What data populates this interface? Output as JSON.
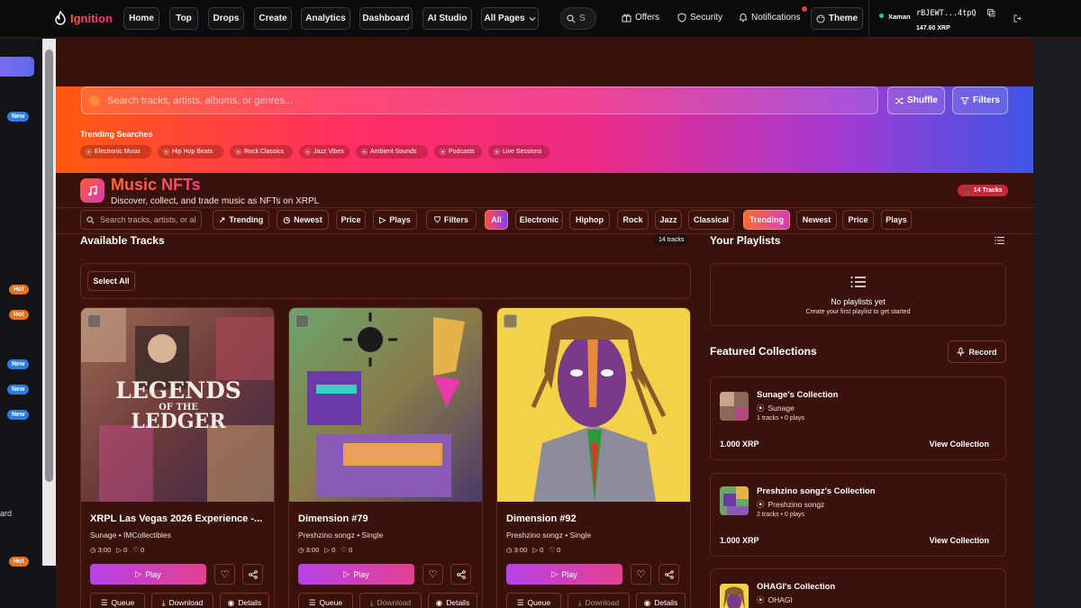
{
  "app": {
    "name": "Ignition"
  },
  "nav": {
    "items": [
      "Home",
      "Top",
      "Drops",
      "Create",
      "Analytics",
      "Dashboard",
      "AI Studio",
      "All Pages"
    ],
    "search_short": "S"
  },
  "top_links": {
    "offers": "Offers",
    "security": "Security",
    "notifications": "Notifications",
    "theme": "Theme"
  },
  "wallet": {
    "provider": "Xaman",
    "address": "rBJEWT...4tpQ",
    "balance": "147.60 XRP"
  },
  "sidebar": {
    "badges": [
      "New",
      "Hot",
      "Hot",
      "New",
      "New",
      "New",
      "Hot"
    ],
    "partial_text": "ard"
  },
  "hero": {
    "search_placeholder": "Search tracks, artists, albums, or genres...",
    "shuffle": "Shuffle",
    "filters": "Filters",
    "trending_label": "Trending Searches",
    "trending": [
      "Electronic Music",
      "Hip Hop Beats",
      "Rock Classics",
      "Jazz Vibes",
      "Ambient Sounds",
      "Podcasts",
      "Live Sessions"
    ]
  },
  "header": {
    "title": "Music NFTs",
    "subtitle": "Discover, collect, and trade music as NFTs on XRPL",
    "tracks_badge": "14 Tracks"
  },
  "filters": {
    "search_placeholder": "Search tracks, artists, or al",
    "sort_a": [
      "Trending",
      "Newest",
      "Price",
      "Plays",
      "Filters"
    ],
    "genres": [
      "All",
      "Electronic",
      "Hiphop",
      "Rock",
      "Jazz",
      "Classical"
    ],
    "sort_b": [
      "Trending",
      "Newest",
      "Price",
      "Plays"
    ]
  },
  "available": {
    "title": "Available Tracks",
    "count": "14 tracks",
    "select_all": "Select All"
  },
  "tracks": [
    {
      "title": "XRPL Las Vegas 2026 Experience -...",
      "meta": "Sunage • IMCollectibles",
      "duration": "3:00",
      "plays": "0",
      "likes": "0",
      "play": "Play",
      "queue": "Queue",
      "download": "Download",
      "details": "Details",
      "art_text": [
        "LEGENDS",
        "OF THE",
        "LEDGER"
      ]
    },
    {
      "title": "Dimension #79",
      "meta": "Preshzino songz • Single",
      "duration": "3:00",
      "plays": "0",
      "likes": "0",
      "play": "Play",
      "queue": "Queue",
      "download": "Download",
      "details": "Details"
    },
    {
      "title": "Dimension #92",
      "meta": "Preshzino songz • Single",
      "duration": "3:00",
      "plays": "0",
      "likes": "0",
      "play": "Play",
      "queue": "Queue",
      "download": "Download",
      "details": "Details"
    }
  ],
  "playlists": {
    "title": "Your Playlists",
    "empty_title": "No playlists yet",
    "empty_sub": "Create your first playlist to get started"
  },
  "featured": {
    "title": "Featured Collections",
    "record": "Record",
    "collections": [
      {
        "name": "Sunage's Collection",
        "artist": "Sunage",
        "tracks": "1 tracks",
        "plays": "0 plays",
        "price": "1.000 XRP",
        "view": "View Collection"
      },
      {
        "name": "Preshzino songz's Collection",
        "artist": "Preshzino songz",
        "tracks": "2 tracks",
        "plays": "0 plays",
        "price": "1.000 XRP",
        "view": "View Collection"
      },
      {
        "name": "OHAGI's Collection",
        "artist": "OHAGI"
      }
    ]
  },
  "colors": {
    "bg": "#3a120b",
    "accent": "#ff3f86",
    "topbar": "#0c0c0e"
  }
}
